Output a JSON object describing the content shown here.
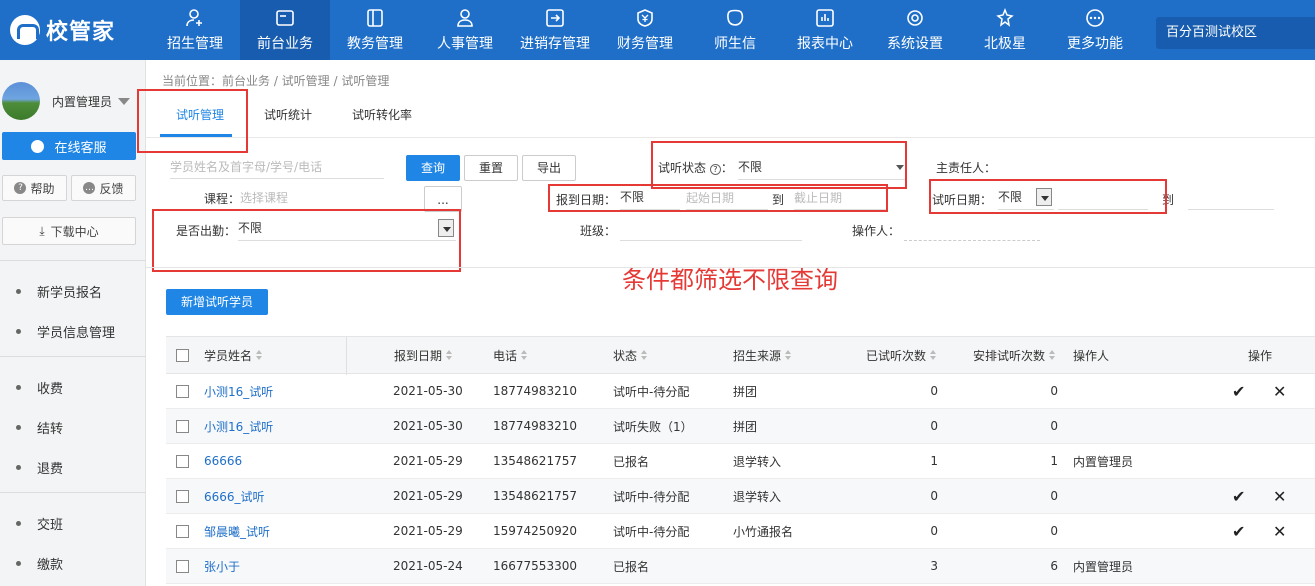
{
  "brand": {
    "name": "校管家"
  },
  "nav": {
    "items": [
      {
        "label": "招生管理",
        "icon": "person-add-icon"
      },
      {
        "label": "前台业务",
        "icon": "frontdesk-icon"
      },
      {
        "label": "教务管理",
        "icon": "book-icon"
      },
      {
        "label": "人事管理",
        "icon": "person-icon"
      },
      {
        "label": "进销存管理",
        "icon": "inventory-icon"
      },
      {
        "label": "财务管理",
        "icon": "finance-icon"
      },
      {
        "label": "师生信",
        "icon": "chat-icon"
      },
      {
        "label": "报表中心",
        "icon": "report-icon"
      },
      {
        "label": "系统设置",
        "icon": "settings-icon"
      },
      {
        "label": "北极星",
        "icon": "star-icon"
      },
      {
        "label": "更多功能",
        "icon": "more-icon"
      }
    ],
    "campus": "百分百测试校区"
  },
  "sidebar": {
    "user_name": "内置管理员",
    "online_service": "在线客服",
    "help": "帮助",
    "feedback": "反馈",
    "download": "下载中心",
    "items": [
      "新学员报名",
      "学员信息管理",
      "收费",
      "结转",
      "退费",
      "交班",
      "缴款"
    ]
  },
  "breadcrumb": "当前位置：前台业务 / 试听管理 / 试听管理",
  "tabs": [
    "试听管理",
    "试听统计",
    "试听转化率"
  ],
  "filters": {
    "search_placeholder": "学员姓名及首字母/学号/电话",
    "query_btn": "查询",
    "reset_btn": "重置",
    "export_btn": "导出",
    "status_label": "试听状态",
    "status_help": "?",
    "status_colon": "：",
    "status_value": "不限",
    "owner_label": "主责任人：",
    "course_label": "课程：",
    "course_placeholder": "选择课程",
    "course_btn": "...",
    "report_date_label": "报到日期：",
    "report_date_value": "不限",
    "start_date_placeholder": "起始日期",
    "to_1": "到",
    "end_date_placeholder": "截止日期",
    "trial_date_label": "试听日期：",
    "trial_date_value": "不限",
    "to_2": "到",
    "attend_label": "是否出勤：",
    "attend_value": "不限",
    "class_label": "班级：",
    "operator_label": "操作人："
  },
  "annotation": "条件都筛选不限查询",
  "add_button": "新增试听学员",
  "table": {
    "headers": [
      "学员姓名",
      "报到日期",
      "电话",
      "状态",
      "招生来源",
      "已试听次数",
      "安排试听次数",
      "操作人",
      "操作"
    ],
    "rows": [
      {
        "name": "小测16_试听",
        "date": "2021-05-30",
        "phone": "18774983210",
        "status": "试听中-待分配",
        "source": "拼团",
        "done": "0",
        "planned": "0",
        "operator": "",
        "actions": true
      },
      {
        "name": "小测16_试听",
        "date": "2021-05-30",
        "phone": "18774983210",
        "status": "试听失败（1）",
        "source": "拼团",
        "done": "0",
        "planned": "0",
        "operator": "",
        "actions": false
      },
      {
        "name": "66666",
        "date": "2021-05-29",
        "phone": "13548621757",
        "status": "已报名",
        "source": "退学转入",
        "done": "1",
        "planned": "1",
        "operator": "内置管理员",
        "actions": false
      },
      {
        "name": "6666_试听",
        "date": "2021-05-29",
        "phone": "13548621757",
        "status": "试听中-待分配",
        "source": "退学转入",
        "done": "0",
        "planned": "0",
        "operator": "",
        "actions": true
      },
      {
        "name": "邹晨曦_试听",
        "date": "2021-05-29",
        "phone": "15974250920",
        "status": "试听中-待分配",
        "source": "小竹通报名",
        "done": "0",
        "planned": "0",
        "operator": "",
        "actions": true
      },
      {
        "name": "张小于",
        "date": "2021-05-24",
        "phone": "16677553300",
        "status": "已报名",
        "source": "",
        "done": "3",
        "planned": "6",
        "operator": "内置管理员",
        "actions": false
      }
    ],
    "confirm_glyph": "✔",
    "delete_glyph": "✕"
  }
}
